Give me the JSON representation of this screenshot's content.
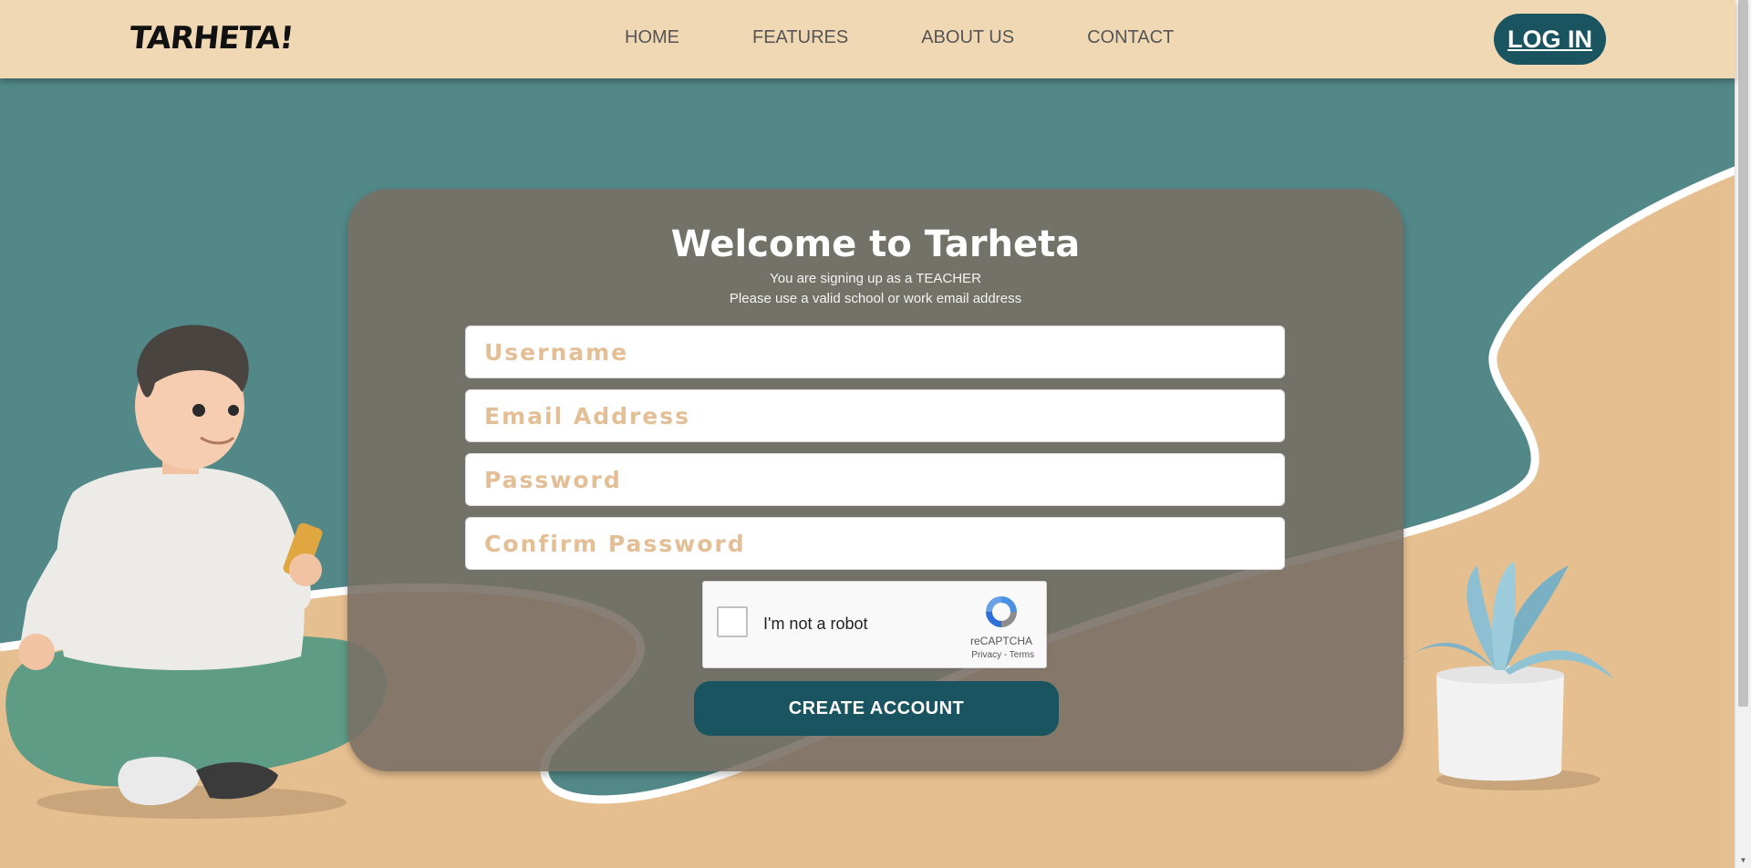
{
  "brand": {
    "logo_text": "TARHETA!"
  },
  "nav": {
    "items": [
      {
        "label": "HOME"
      },
      {
        "label": "FEATURES"
      },
      {
        "label": "ABOUT US"
      },
      {
        "label": "CONTACT"
      }
    ],
    "login_label": "LOG IN"
  },
  "form": {
    "title": "Welcome to Tarheta",
    "subtitle_1": "You are signing up as a TEACHER",
    "subtitle_2": "Please use a valid school or work email address",
    "username_placeholder": "Username",
    "email_placeholder": "Email Address",
    "password_placeholder": "Password",
    "confirm_password_placeholder": "Confirm Password",
    "username_value": "",
    "email_value": "",
    "password_value": "",
    "confirm_password_value": "",
    "recaptcha": {
      "label": "I'm not a robot",
      "brand": "reCAPTCHA",
      "links": "Privacy - Terms",
      "checked": false
    },
    "submit_label": "CREATE ACCOUNT"
  },
  "colors": {
    "nav_bg": "#f1d8b4",
    "primary": "#1a5460",
    "teal_bg": "#528888",
    "sand_bg": "#e6bf90",
    "placeholder": "#e4be94"
  }
}
